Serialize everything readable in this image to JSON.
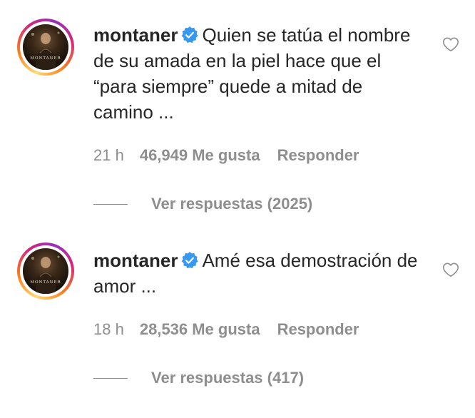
{
  "comments": [
    {
      "username": "montaner",
      "verified": true,
      "avatar_caption": "MONTANER",
      "text": "Quien se tatúa el nombre de su amada en la piel hace que el “para siempre” quede a mitad de camino ...",
      "time": "21 h",
      "likes": "46,949 Me gusta",
      "reply_label": "Responder",
      "view_replies": "Ver respuestas (2025)"
    },
    {
      "username": "montaner",
      "verified": true,
      "avatar_caption": "MONTANER",
      "text": "Amé esa demostración de amor ...",
      "time": "18 h",
      "likes": "28,536 Me gusta",
      "reply_label": "Responder",
      "view_replies": "Ver respuestas (417)"
    }
  ],
  "icons": {
    "verified": "verified-badge-icon",
    "like": "heart-outline-icon"
  },
  "colors": {
    "text": "#262626",
    "secondary": "#8e8e8e",
    "verified": "#3897f0"
  }
}
